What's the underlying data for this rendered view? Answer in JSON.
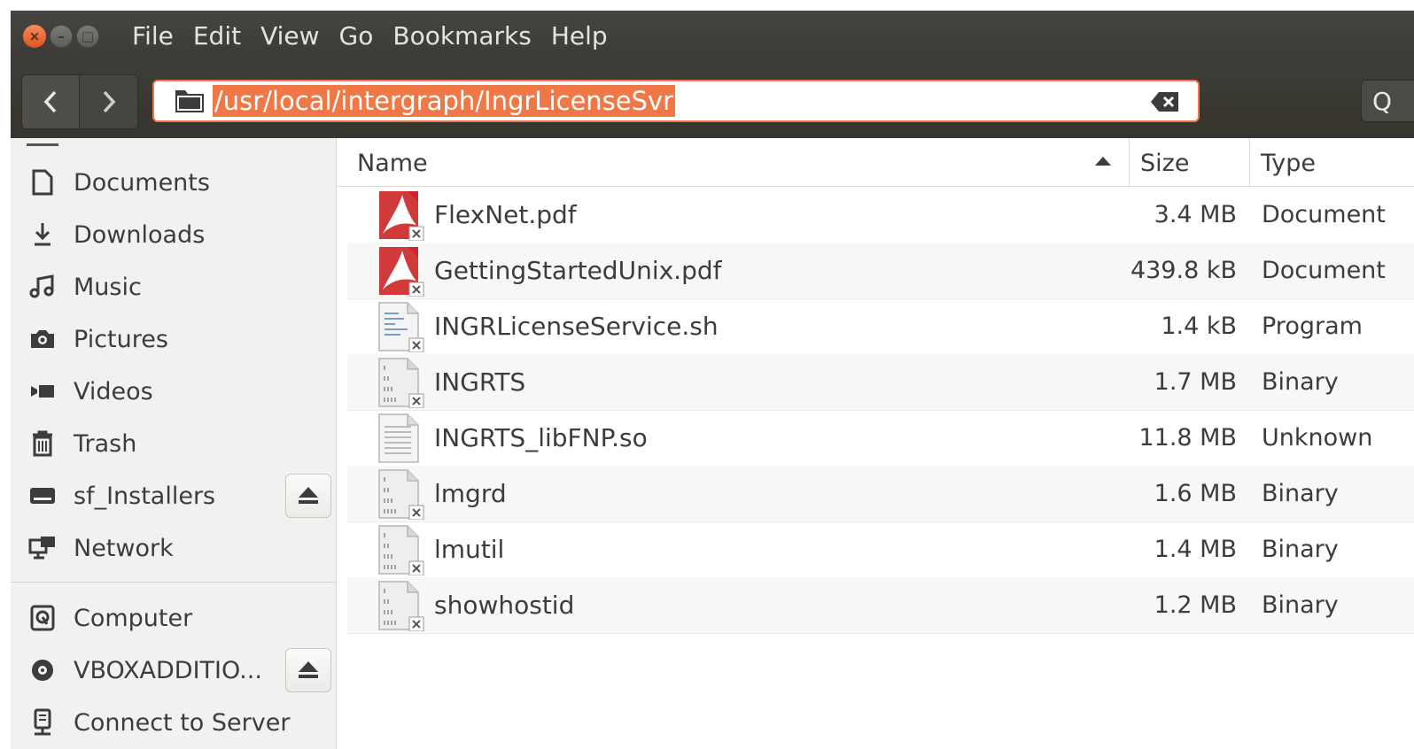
{
  "window": {
    "controls": {
      "close": "×",
      "minimize": "–",
      "maximize": "□"
    }
  },
  "menubar": {
    "items": [
      "File",
      "Edit",
      "View",
      "Go",
      "Bookmarks",
      "Help"
    ]
  },
  "toolbar": {
    "back": "‹",
    "forward": "›",
    "path": "/usr/local/intergraph/IngrLicenseSvr",
    "search_glyph": "Q"
  },
  "sidebar": {
    "items": [
      {
        "label": "Documents",
        "icon": "document-icon"
      },
      {
        "label": "Downloads",
        "icon": "download-icon"
      },
      {
        "label": "Music",
        "icon": "music-icon"
      },
      {
        "label": "Pictures",
        "icon": "camera-icon"
      },
      {
        "label": "Videos",
        "icon": "video-icon"
      },
      {
        "label": "Trash",
        "icon": "trash-icon"
      },
      {
        "label": "sf_Installers",
        "icon": "drive-icon",
        "eject": true
      },
      {
        "label": "Network",
        "icon": "network-icon"
      },
      {
        "label": "Computer",
        "icon": "computer-icon"
      },
      {
        "label": "VBOXADDITIO...",
        "icon": "disc-icon",
        "eject": true
      },
      {
        "label": "Connect to Server",
        "icon": "server-icon"
      }
    ]
  },
  "filelist": {
    "columns": {
      "name": "Name",
      "size": "Size",
      "type": "Type"
    },
    "sort": "name-ascending",
    "files": [
      {
        "name": "FlexNet.pdf",
        "size": "3.4 MB",
        "type": "Document",
        "icon": "pdf-icon"
      },
      {
        "name": "GettingStartedUnix.pdf",
        "size": "439.8 kB",
        "type": "Document",
        "icon": "pdf-icon"
      },
      {
        "name": "INGRLicenseService.sh",
        "size": "1.4 kB",
        "type": "Program",
        "icon": "script-icon"
      },
      {
        "name": "INGRTS",
        "size": "1.7 MB",
        "type": "Binary",
        "icon": "binary-icon"
      },
      {
        "name": "INGRTS_libFNP.so",
        "size": "11.8 MB",
        "type": "Unknown",
        "icon": "text-file-icon"
      },
      {
        "name": "lmgrd",
        "size": "1.6 MB",
        "type": "Binary",
        "icon": "binary-icon"
      },
      {
        "name": "lmutil",
        "size": "1.4 MB",
        "type": "Binary",
        "icon": "binary-icon"
      },
      {
        "name": "showhostid",
        "size": "1.2 MB",
        "type": "Binary",
        "icon": "binary-icon"
      }
    ]
  }
}
